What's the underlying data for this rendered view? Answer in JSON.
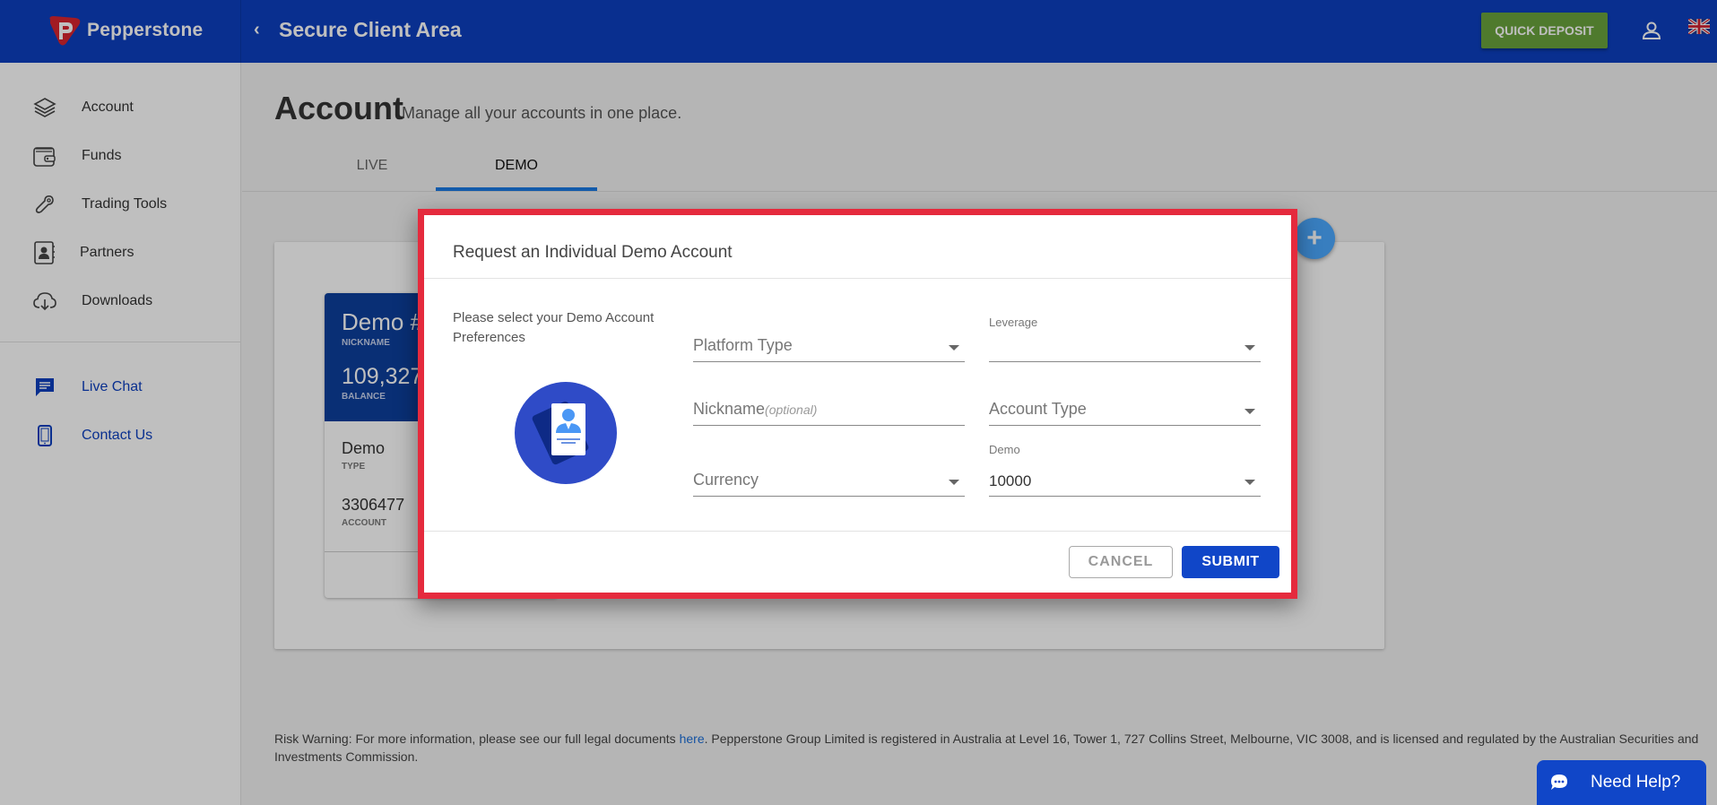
{
  "header": {
    "brand": "Pepperstone",
    "title": "Secure Client Area",
    "quick_deposit": "QUICK DEPOSIT"
  },
  "sidebar": {
    "items": [
      {
        "label": "Account",
        "icon": "layers-icon"
      },
      {
        "label": "Funds",
        "icon": "wallet-icon"
      },
      {
        "label": "Trading Tools",
        "icon": "wrench-icon"
      },
      {
        "label": "Partners",
        "icon": "contact-book-icon"
      },
      {
        "label": "Downloads",
        "icon": "cloud-download-icon"
      }
    ],
    "support": [
      {
        "label": "Live Chat",
        "icon": "chat-icon"
      },
      {
        "label": "Contact Us",
        "icon": "phone-icon"
      }
    ]
  },
  "page": {
    "title": "Account",
    "subtitle": "Manage all your accounts in one place.",
    "tabs": [
      {
        "label": "LIVE",
        "active": false
      },
      {
        "label": "DEMO",
        "active": true
      }
    ]
  },
  "account_card": {
    "nickname": "Demo #",
    "nickname_label": "NICKNAME",
    "balance": "109,327",
    "balance_label": "BALANCE",
    "type": "Demo",
    "type_label": "TYPE",
    "account": "3306477",
    "account_label": "ACCOUNT"
  },
  "fab": {
    "label": "+"
  },
  "footer": {
    "risk_prefix": "Risk Warning: For more information, please see our full legal documents ",
    "risk_link": "here",
    "risk_suffix": ". Pepperstone Group Limited is registered in Australia at Level 16, Tower 1, 727 Collins Street, Melbourne, VIC 3008, and is licensed and regulated by the Australian Securities and Investments Commission."
  },
  "need_help": {
    "label": "Need Help?"
  },
  "modal": {
    "title": "Request an Individual Demo Account",
    "intro": "Please select your Demo Account Preferences",
    "fields": {
      "platform_type": {
        "placeholder": "Platform Type",
        "value": ""
      },
      "nickname": {
        "placeholder": "Nickname",
        "hint": "(optional)",
        "value": ""
      },
      "currency": {
        "placeholder": "Currency",
        "value": ""
      },
      "leverage": {
        "label": "Leverage",
        "value": ""
      },
      "account_type": {
        "placeholder": "Account Type",
        "value": ""
      },
      "demo_balance": {
        "label": "Demo",
        "value": "10000"
      }
    },
    "cancel": "CANCEL",
    "submit": "SUBMIT"
  },
  "colors": {
    "header": "#0c3fbf",
    "quick_deposit": "#6aa33c",
    "modal_highlight": "#e52a3d",
    "submit": "#1046c8",
    "tab_indicator": "#1a7ae4"
  }
}
